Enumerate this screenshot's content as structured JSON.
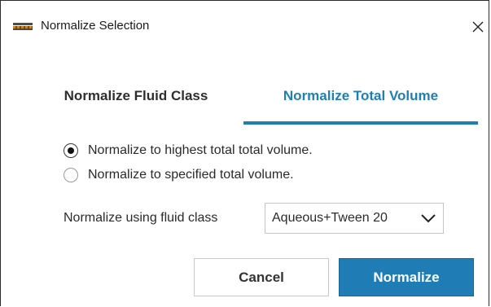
{
  "window": {
    "title": "Normalize Selection",
    "app_icon": "instrument-app-icon",
    "close_icon": "close-icon"
  },
  "tabs": [
    {
      "label": "Normalize Fluid Class",
      "active": false
    },
    {
      "label": "Normalize Total Volume",
      "active": true
    }
  ],
  "options": {
    "selected_index": 0,
    "items": [
      {
        "label": "Normalize to highest total total volume.",
        "checked": true
      },
      {
        "label": "Normalize to specified total volume.",
        "checked": false
      }
    ]
  },
  "fluid_class": {
    "label": "Normalize using fluid class",
    "selected_value": "Aqueous+Tween 20",
    "dropdown_icon": "chevron-down-icon"
  },
  "buttons": {
    "cancel": "Cancel",
    "normalize": "Normalize"
  },
  "colors": {
    "accent": "#1f7cb4",
    "active_tab_text": "#1f7fb4",
    "text": "#2a2a2a",
    "border": "#c4c4c4"
  }
}
